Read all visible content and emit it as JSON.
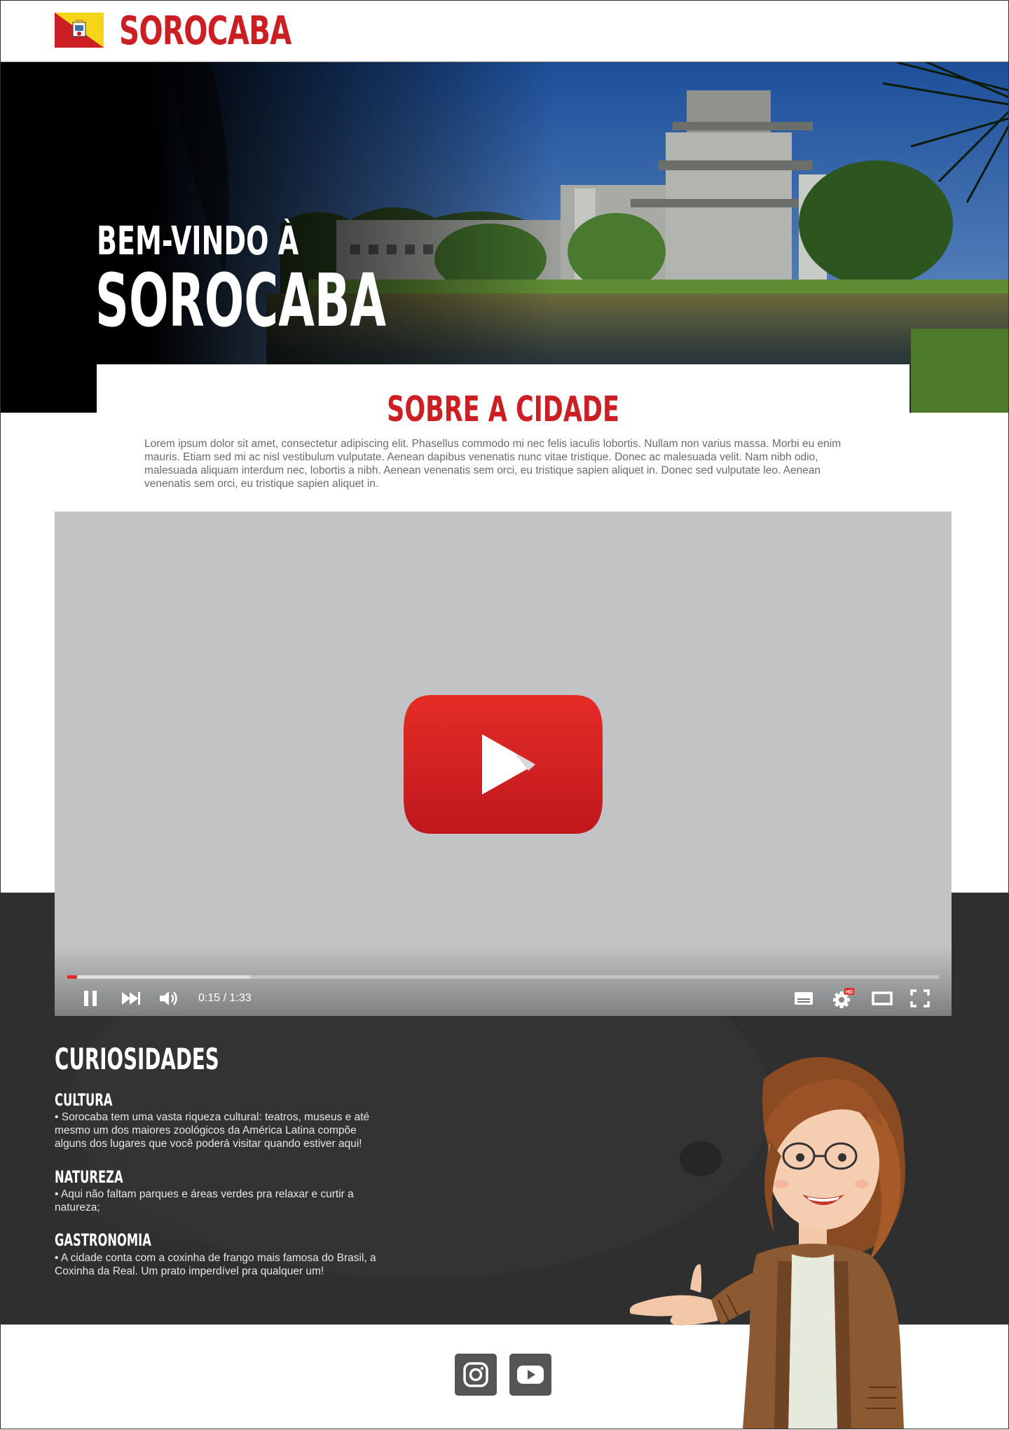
{
  "header": {
    "brand": "SOROCABA"
  },
  "hero": {
    "welcome_line": "BEM-VINDO À",
    "city_name": "SOROCABA"
  },
  "about": {
    "title": "SOBRE A CIDADE",
    "text": "Lorem ipsum dolor sit amet, consectetur adipiscing elit. Phasellus commodo mi nec felis iaculis lobortis. Nullam non varius massa. Morbi eu enim mauris. Etiam sed mi ac nisl vestibulum vulputate. Aenean dapibus venenatis nunc vitae tristique. Donec ac malesuada velit. Nam nibh odio, malesuada aliquam interdum nec, lobortis a nibh. Aenean venenatis sem orci, eu tristique sapien aliquet in. Donec sed vulputate leo. Aenean venenatis sem orci, eu tristique sapien aliquet in."
  },
  "video": {
    "time": "0:15 / 1:33",
    "played_fraction": 0.01,
    "buffered_fraction": 0.21,
    "quality_badge": "HD",
    "controls": [
      "pause-icon",
      "next-icon",
      "volume-icon",
      "subtitles-icon",
      "settings-icon",
      "theater-mode-icon",
      "fullscreen-icon"
    ],
    "accent_color": "#e52d27"
  },
  "curiosidades": {
    "title": "CURIOSIDADES",
    "items": [
      {
        "title": "CULTURA",
        "text": "• Sorocaba tem uma vasta riqueza cultural: teatros, museus e até mesmo um dos maiores zoológicos da América Latina compõe alguns dos lugares que você poderá visitar quando estiver aqui!"
      },
      {
        "title": "NATUREZA",
        "text": "• Aqui não faltam parques e áreas verdes pra relaxar e curtir a natureza;"
      },
      {
        "title": "GASTRONOMIA",
        "text": "• A cidade conta com a coxinha de frango mais famosa do Brasil, a Coxinha da Real. Um prato imperdível pra qualquer um!"
      }
    ]
  },
  "footer": {
    "social": [
      "instagram-icon",
      "youtube-icon"
    ]
  },
  "colors": {
    "brand_red": "#cc1f24",
    "dark_band": "#2f2f2f",
    "video_bg": "#c2c3c5",
    "social_bg": "#555555"
  }
}
